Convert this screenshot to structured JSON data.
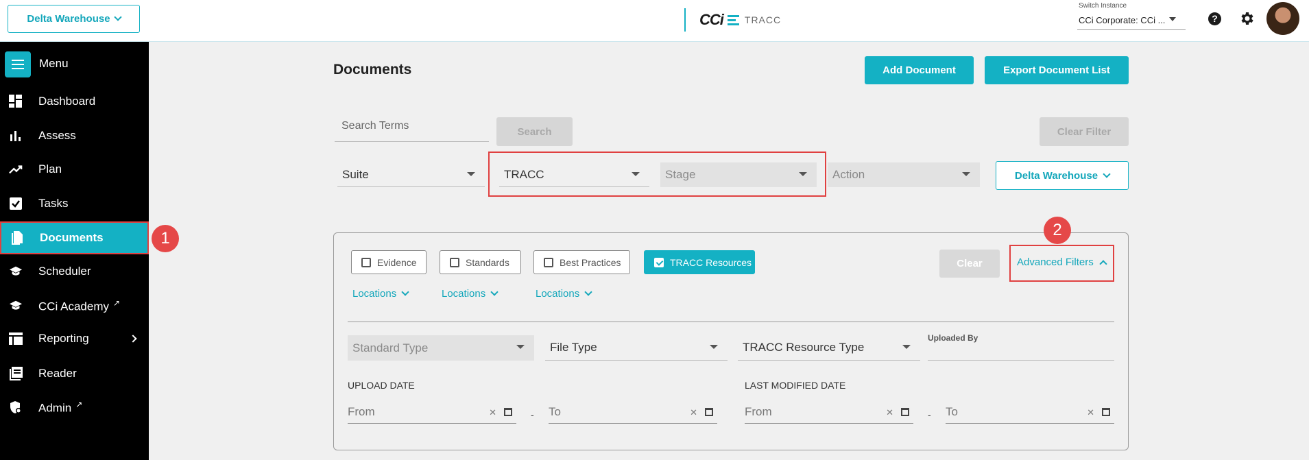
{
  "topbar": {
    "warehouse_button": "Delta Warehouse",
    "logo_text": "CCi",
    "logo_product": "TRACC",
    "switch_instance_label": "Switch Instance",
    "switch_instance_value": "CCi Corporate: CCi ..."
  },
  "sidebar": {
    "menu_label": "Menu",
    "items": [
      {
        "label": "Dashboard",
        "icon": "dashboard-icon"
      },
      {
        "label": "Assess",
        "icon": "bar-chart-icon"
      },
      {
        "label": "Plan",
        "icon": "trend-icon"
      },
      {
        "label": "Tasks",
        "icon": "checkbox-icon"
      },
      {
        "label": "Documents",
        "icon": "document-icon",
        "active": true
      },
      {
        "label": "Scheduler",
        "icon": "mortarboard-icon"
      },
      {
        "label": "CCi Academy",
        "icon": "mortarboard-icon",
        "external": true
      },
      {
        "label": "Reporting",
        "icon": "table-icon",
        "submenu": true
      },
      {
        "label": "Reader",
        "icon": "reader-icon"
      },
      {
        "label": "Admin",
        "icon": "admin-icon",
        "external": true
      }
    ]
  },
  "callouts": {
    "one": "1",
    "two": "2"
  },
  "main": {
    "title": "Documents",
    "add_document": "Add Document",
    "export_list": "Export Document List",
    "search_placeholder": "Search Terms",
    "search_button": "Search",
    "clear_filter_button": "Clear Filter",
    "suite": "Suite",
    "tracc": "TRACC",
    "stage": "Stage",
    "action": "Action",
    "warehouse_dropdown": "Delta Warehouse"
  },
  "panel": {
    "chips": [
      {
        "label": "Evidence",
        "checked": false
      },
      {
        "label": "Standards",
        "checked": false
      },
      {
        "label": "Best Practices",
        "checked": false
      },
      {
        "label": "TRACC Resources",
        "checked": true
      }
    ],
    "locations": [
      "Locations",
      "Locations",
      "Locations"
    ],
    "clear_button": "Clear",
    "advanced_filters": "Advanced Filters",
    "standard_type": "Standard Type",
    "file_type": "File Type",
    "tracc_resource_type": "TRACC Resource Type",
    "uploaded_by": "Uploaded By",
    "upload_date_label": "UPLOAD DATE",
    "last_modified_label": "LAST MODIFIED DATE",
    "from": "From",
    "to": "To"
  },
  "colors": {
    "accent": "#14b1c4",
    "highlight": "#e04040",
    "sidebar": "#000000"
  }
}
